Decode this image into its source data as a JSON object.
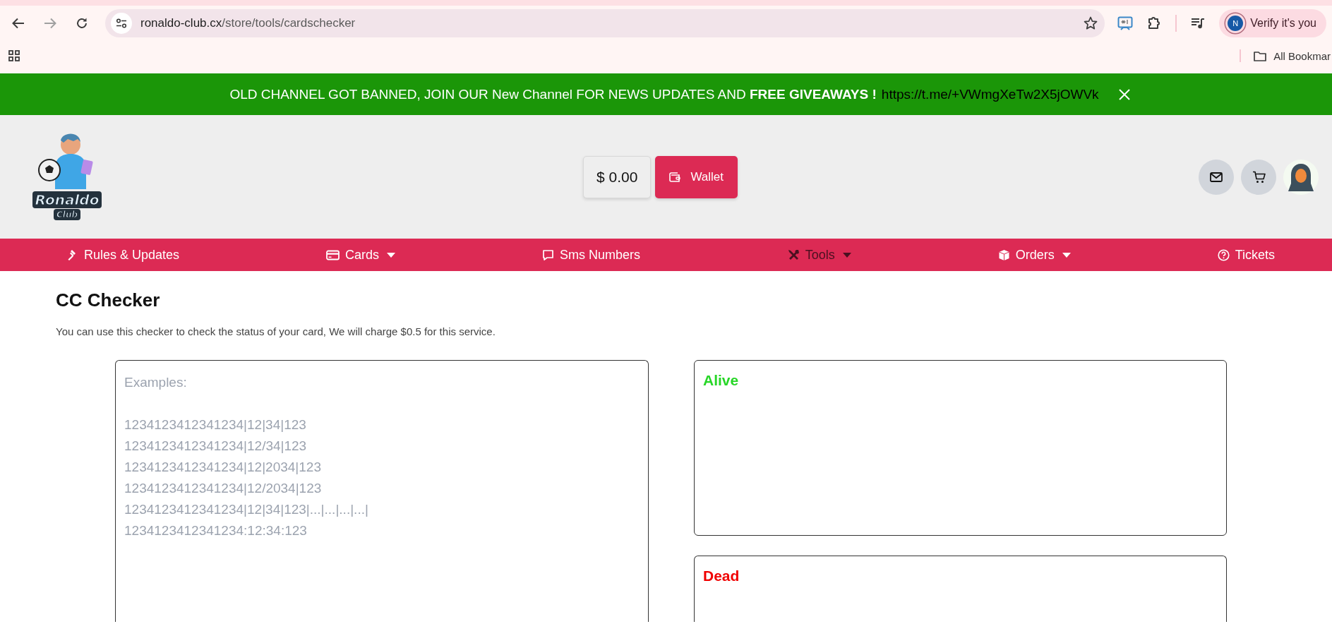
{
  "browser": {
    "url_host": "ronaldo-club.cx",
    "url_path": "/store/tools/cardschecker",
    "profile_initial": "N",
    "profile_label": "Verify it's you",
    "bookmarks_label": "All Bookmar"
  },
  "banner": {
    "text": "OLD CHANNEL GOT BANNED, JOIN OUR New Channel FOR NEWS UPDATES AND **FREE GIVEAWAYS !**",
    "link": "https://t.me/+VWmgXeTw2X5jOWVk"
  },
  "header": {
    "logo_lines": [
      "Ronaldo",
      "Club"
    ],
    "balance": "$ 0.00",
    "wallet_label": "Wallet"
  },
  "nav": [
    {
      "label": "Rules & Updates",
      "dropdown": false,
      "selected": false
    },
    {
      "label": "Cards",
      "dropdown": true,
      "selected": false
    },
    {
      "label": "Sms Numbers",
      "dropdown": false,
      "selected": false
    },
    {
      "label": "Tools",
      "dropdown": true,
      "selected": true
    },
    {
      "label": "Orders",
      "dropdown": true,
      "selected": false
    },
    {
      "label": "Tickets",
      "dropdown": false,
      "selected": false
    }
  ],
  "page": {
    "title": "CC Checker",
    "description": "You can use this checker to check the status of your card, We will charge $0.5 for this service.",
    "input": {
      "placeholder": "Examples:\n\n1234123412341234|12|34|123\n1234123412341234|12/34|123\n1234123412341234|12|2034|123\n1234123412341234|12/2034|123\n1234123412341234|12|34|123|...|...|...|...|\n1234123412341234:12:34:123"
    },
    "panels": [
      {
        "title": "Alive",
        "kind": "alive"
      },
      {
        "title": "Dead",
        "kind": "dead"
      }
    ]
  }
}
